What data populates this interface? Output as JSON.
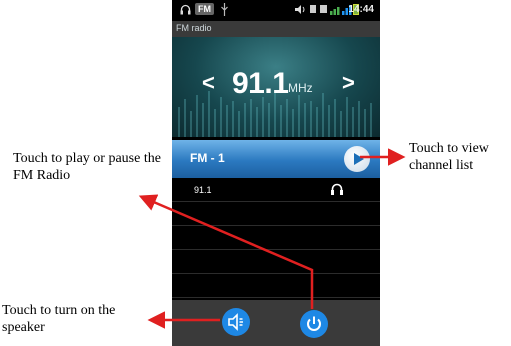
{
  "status_bar": {
    "fm_indicator": "FM",
    "time": "14:44",
    "icons": [
      "headphone-icon",
      "usb-icon",
      "volume-icon",
      "sim-icon",
      "signal-icon",
      "battery-icon"
    ]
  },
  "app": {
    "title": "FM radio"
  },
  "tuner": {
    "frequency": "91.1",
    "unit": "MHz",
    "prev_label": "<",
    "next_label": ">"
  },
  "station": {
    "name": "FM - 1"
  },
  "channels": [
    {
      "label": "91.1",
      "icon": "headphone-icon"
    },
    {
      "label": ""
    },
    {
      "label": ""
    },
    {
      "label": ""
    },
    {
      "label": ""
    }
  ],
  "annotations": {
    "play": "Touch to play or pause the FM Radio",
    "channel_list": "Touch to view channel list",
    "speaker": "Touch to turn on the speaker"
  },
  "colors": {
    "accent": "#1e88e5",
    "arrow": "#e02020",
    "tuner_bg": "#16474e"
  }
}
